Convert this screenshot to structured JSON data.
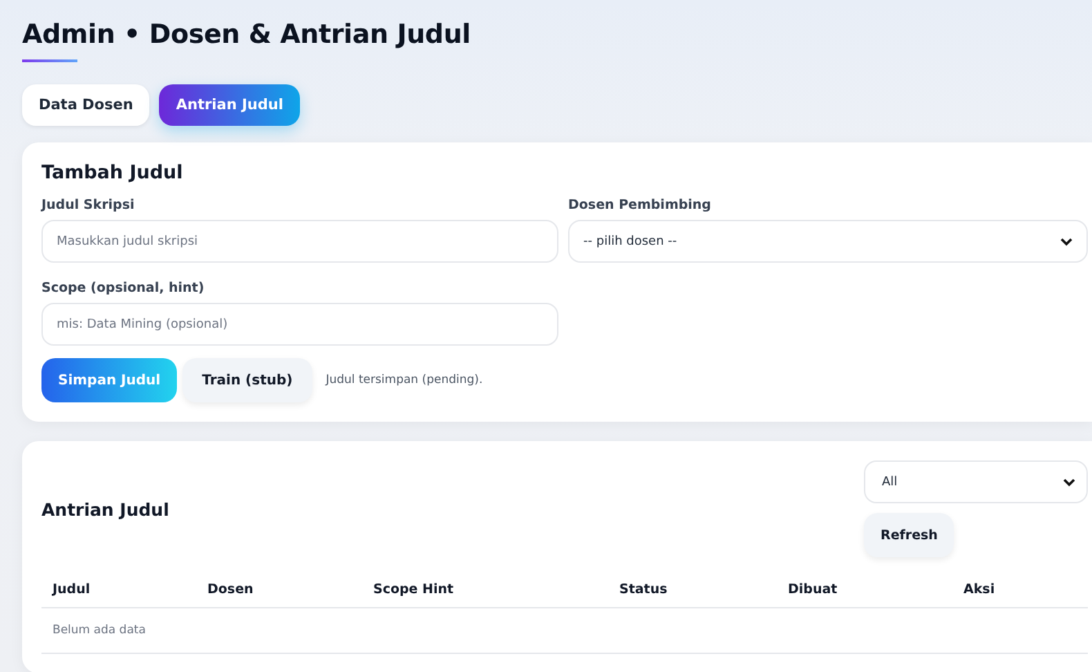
{
  "page": {
    "title": "Admin • Dosen & Antrian Judul"
  },
  "tabs": [
    {
      "label": "Data Dosen",
      "selected": false
    },
    {
      "label": "Antrian Judul",
      "selected": true
    }
  ],
  "form": {
    "title": "Tambah Judul",
    "fields": [
      {
        "kind": "input",
        "label": "Judul Skripsi",
        "placeholder": "Masukkan judul skripsi"
      },
      {
        "kind": "select",
        "label": "Dosen Pembimbing",
        "value": "-- pilih dosen --"
      },
      {
        "kind": "input",
        "label": "Scope (opsional, hint)",
        "placeholder": "mis: Data Mining (opsional)"
      }
    ],
    "buttons": [
      {
        "label": "Simpan Judul",
        "kind": "primary"
      },
      {
        "label": "Train (stub)",
        "kind": "secondary"
      }
    ],
    "message": "Judul tersimpan (pending)."
  },
  "queue": {
    "title": "Antrian Judul",
    "filter": {
      "value": "All"
    },
    "refresh_button": "Refresh",
    "table": {
      "columns": [
        "Judul",
        "Dosen",
        "Scope Hint",
        "Status",
        "Dibuat",
        "Aksi"
      ],
      "empty_text": "Belum ada data"
    }
  }
}
